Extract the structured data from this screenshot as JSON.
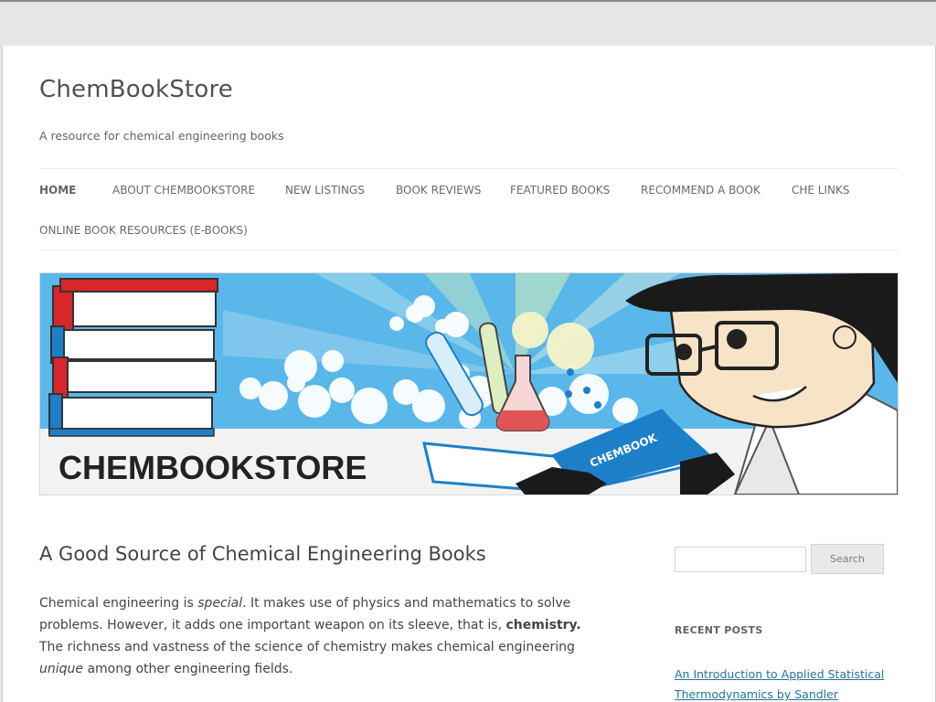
{
  "site": {
    "title": "ChemBookStore",
    "description": "A resource for chemical engineering books"
  },
  "nav": {
    "items": [
      {
        "label": "HOME",
        "active": true
      },
      {
        "label": "ABOUT CHEMBOOKSTORE"
      },
      {
        "label": "NEW LISTINGS"
      },
      {
        "label": "BOOK REVIEWS"
      },
      {
        "label": "FEATURED BOOKS"
      },
      {
        "label": "RECOMMEND A BOOK"
      },
      {
        "label": "CHE LINKS"
      },
      {
        "label": "ONLINE BOOK RESOURCES (E-BOOKS)"
      }
    ]
  },
  "banner": {
    "text": "CHEMBOOKSTORE",
    "book_text": "CHEMBOOK"
  },
  "post": {
    "title": "A Good Source of Chemical Engineering Books",
    "p1": "Chemical engineering is ",
    "em1": "special",
    "p2": ". It makes use of physics and mathematics to solve problems. However, it adds one important weapon on its sleeve, that is, ",
    "strong1": "chemistry.",
    "p3": " The richness and vastness of the science of chemistry makes chemical engineering ",
    "em2": "unique",
    "p4": " among other engineering fields."
  },
  "sidebar": {
    "search_placeholder": "",
    "search_button": "Search",
    "recent_posts_title": "RECENT POSTS",
    "recent_posts": [
      "An Introduction to Applied Statistical Thermodynamics by Sandler"
    ]
  },
  "colors": {
    "link": "#21759b",
    "book_red": "#d9262a",
    "book_blue": "#1e7fc9",
    "sky": "#6fc3ef"
  }
}
